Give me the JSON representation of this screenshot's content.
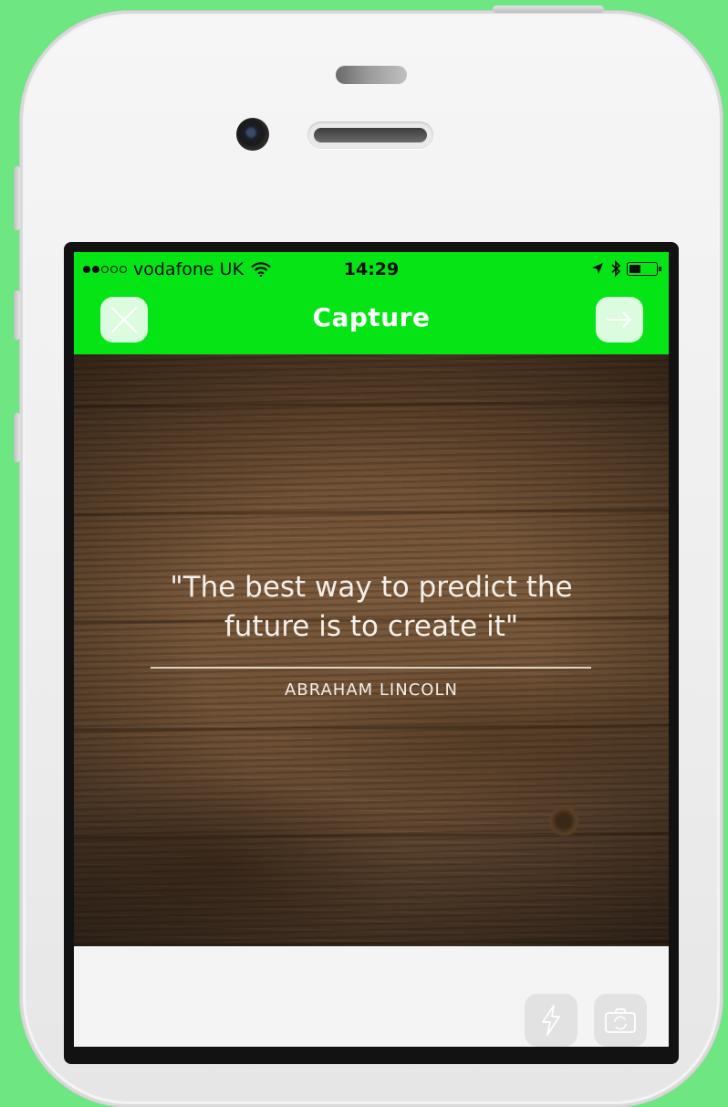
{
  "status_bar": {
    "signal_dots": [
      true,
      true,
      false,
      false,
      false
    ],
    "carrier": "vodafone UK",
    "time": "14:29",
    "battery_level": 0.45
  },
  "nav": {
    "title": "Capture",
    "close_icon": "close-x-icon",
    "next_icon": "arrow-right-icon"
  },
  "preview": {
    "quote": "\"The best way to predict the future is to create it\"",
    "quote_line1": "\"The best way to predict the",
    "quote_line2": "future is to create it\"",
    "author": "ABRAHAM LINCOLN"
  },
  "controls": {
    "flash_icon": "flash-icon",
    "flip_icon": "camera-flip-icon"
  },
  "colors": {
    "background": "#6ee682",
    "header": "#05e515"
  }
}
